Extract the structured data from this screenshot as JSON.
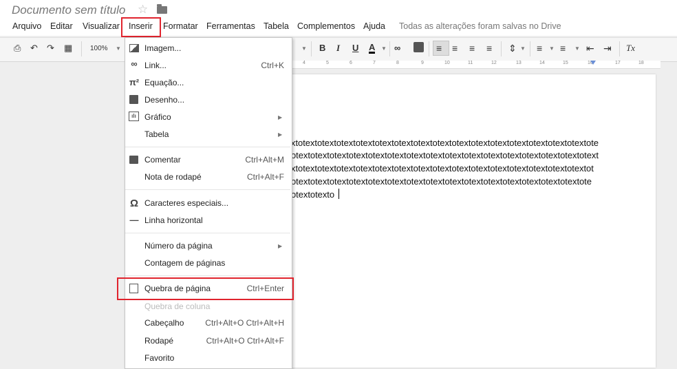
{
  "doc_title": "Documento sem título",
  "menu": [
    {
      "label": "Arquivo"
    },
    {
      "label": "Editar"
    },
    {
      "label": "Visualizar"
    },
    {
      "label": "Inserir"
    },
    {
      "label": "Formatar"
    },
    {
      "label": "Ferramentas"
    },
    {
      "label": "Tabela"
    },
    {
      "label": "Complementos"
    },
    {
      "label": "Ajuda"
    }
  ],
  "saved_status": "Todas as alterações foram salvas no Drive",
  "toolbar": {
    "zoom": "100%",
    "bold": "B",
    "italic": "I",
    "underline": "U",
    "text_color": "A",
    "clear_format": "Tx"
  },
  "ruler_ticks": [
    "4",
    "5",
    "6",
    "7",
    "8",
    "9",
    "10",
    "11",
    "12",
    "13",
    "14",
    "15",
    "16",
    "17",
    "18"
  ],
  "document_lines": [
    "xtotextotextotextotextotextotextotextotextotextotextotextotextotextotextotextote",
    "otextotextotextotextotextotextotextotextotextotextotextotextotextotextotextotext",
    "xtotextotextotextotextotextotextotextotextotextotextotextotextotextotextotextot",
    "otextotextotextotextotextotextotextotextotextotextotextotextotextotextotextote",
    "otextotexto"
  ],
  "insert_menu": {
    "items": [
      {
        "label": "Imagem...",
        "shortcut": "",
        "icon": "image-icon"
      },
      {
        "label": "Link...",
        "shortcut": "Ctrl+K",
        "icon": "link-icon"
      },
      {
        "label": "Equação...",
        "shortcut": "",
        "icon": "pi-icon",
        "icon_text": "π²"
      },
      {
        "label": "Desenho...",
        "shortcut": "",
        "icon": "drawing-icon"
      },
      {
        "label": "Gráfico",
        "shortcut": "",
        "icon": "chart-icon",
        "submenu": true
      },
      {
        "label": "Tabela",
        "shortcut": "",
        "submenu": true
      },
      {
        "label": "Comentar",
        "shortcut": "Ctrl+Alt+M",
        "icon": "comment-icon"
      },
      {
        "label": "Nota de rodapé",
        "shortcut": "Ctrl+Alt+F"
      },
      {
        "label": "Caracteres especiais...",
        "shortcut": "",
        "icon": "omega-icon",
        "icon_text": "Ω"
      },
      {
        "label": "Linha horizontal",
        "shortcut": "",
        "icon": "horizontal-line-icon",
        "icon_text": "—"
      },
      {
        "label": "Número da página",
        "shortcut": "",
        "submenu": true
      },
      {
        "label": "Contagem de páginas",
        "shortcut": ""
      },
      {
        "label": "Quebra de página",
        "shortcut": "Ctrl+Enter",
        "icon": "page-break-icon"
      },
      {
        "label": "Quebra de coluna",
        "shortcut": "",
        "disabled": true
      },
      {
        "label": "Cabeçalho",
        "shortcut": "Ctrl+Alt+O Ctrl+Alt+H"
      },
      {
        "label": "Rodapé",
        "shortcut": "Ctrl+Alt+O Ctrl+Alt+F"
      },
      {
        "label": "Favorito",
        "shortcut": ""
      }
    ]
  },
  "colors": {
    "highlight": "#e0232d",
    "ruler_marker": "#6a8fd6",
    "text_color_bar": "#000000"
  }
}
